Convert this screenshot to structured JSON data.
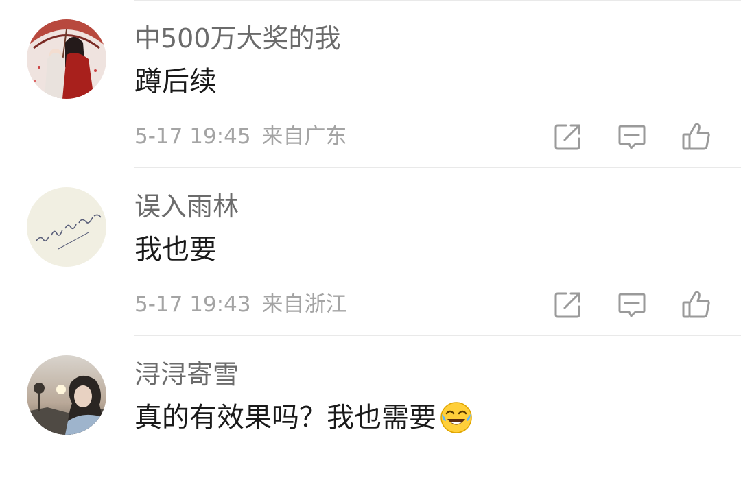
{
  "comments": [
    {
      "username": "中500万大奖的我",
      "text": "蹲后续",
      "time": "5-17 19:45",
      "location": "来自广东",
      "avatar_icon": "couple-illustration-avatar",
      "emoji": null
    },
    {
      "username": "误入雨林",
      "text": "我也要",
      "time": "5-17 19:43",
      "location": "来自浙江",
      "avatar_icon": "handwriting-avatar",
      "emoji": null
    },
    {
      "username": "浔浔寄雪",
      "text": "真的有效果吗？我也需要",
      "time": "",
      "location": "",
      "avatar_icon": "sunset-portrait-avatar",
      "emoji": "laughing-crying-emoji"
    }
  ],
  "actions": {
    "share_icon": "share-icon",
    "reply_icon": "comment-reply-icon",
    "like_icon": "thumbs-up-icon"
  },
  "colors": {
    "username": "#6b6b6b",
    "content": "#1a1a1a",
    "meta": "#a4a4a4",
    "icon": "#9a9a9a",
    "divider": "#e9e9e9"
  }
}
